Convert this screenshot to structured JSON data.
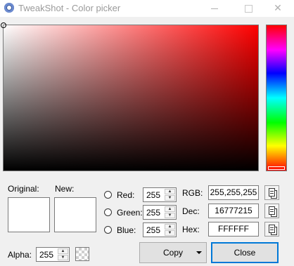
{
  "window": {
    "title": "TweakShot - Color picker",
    "icon": "app-icon"
  },
  "swatches": {
    "original_label": "Original:",
    "new_label": "New:",
    "original_color": "#FFFFFF",
    "new_color": "#FFFFFF"
  },
  "channels": {
    "red_label": "Red:",
    "red_value": "255",
    "green_label": "Green:",
    "green_value": "255",
    "blue_label": "Blue:",
    "blue_value": "255"
  },
  "formats": {
    "rgb_label": "RGB:",
    "rgb_value": "255,255,255",
    "dec_label": "Dec:",
    "dec_value": "16777215",
    "hex_label": "Hex:",
    "hex_value": "FFFFFF"
  },
  "alpha": {
    "label": "Alpha:",
    "value": "255"
  },
  "buttons": {
    "copy_label": "Copy",
    "close_label": "Close"
  },
  "colors": {
    "hue": "#FF0000",
    "focus_border": "#0078D7"
  }
}
